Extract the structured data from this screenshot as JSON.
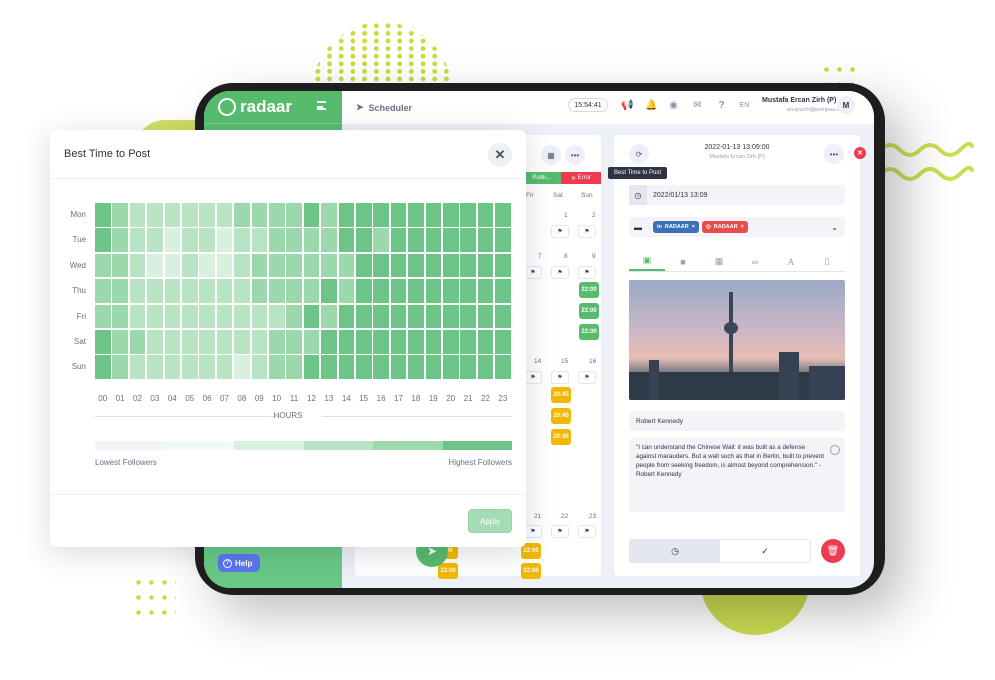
{
  "app": {
    "brand": "radaar",
    "section": "Scheduler",
    "clock": "15:54:41",
    "language": "EN",
    "user": {
      "name": "Mustafa Ercan Zirh (P)",
      "email": "ercanzirh@pompaa.com",
      "initial": "M"
    },
    "help_label": "Help"
  },
  "calendar": {
    "status_tags": {
      "published": "Publi...",
      "error": "Error"
    },
    "day_headers": [
      "Fri",
      "Sat",
      "Sun"
    ],
    "dates": [
      "1",
      "2",
      "7",
      "8",
      "9",
      "14",
      "15",
      "16",
      "21",
      "22",
      "23"
    ],
    "events": {
      "green": [
        "22:00",
        "22:00",
        "22:00"
      ],
      "yellow_mid": [
        "20:45",
        "20:45",
        "20:45"
      ],
      "yellow_bottom_left": [
        ":00",
        "23:00"
      ],
      "yellow_bottom_right": [
        "22:00",
        "22:00"
      ]
    }
  },
  "editor": {
    "timestamp": "2022-01-13 13:09:00",
    "author": "Mustafa Ercan Zirh (P)",
    "tooltip": "Best Time to Post",
    "date_value": "2022/01/13 13:09",
    "accounts": [
      {
        "network": "linkedin",
        "label": "RADAAR",
        "color": "#3b6fb6"
      },
      {
        "network": "instagram",
        "label": "RADAAR",
        "color": "#ea4b4b"
      }
    ],
    "tabs": [
      "image",
      "video",
      "gallery",
      "link",
      "text",
      "mobile"
    ],
    "title_value": "Robert Kennedy",
    "body_value": "\"I can understand the Chinese Wall: it was built as a defense against marauders. But a wall such as that in Berlin, built to prevent people from seeking freedom, is almost beyond comprehension.\" -Robert Kennedy"
  },
  "modal": {
    "title": "Best Time to Post",
    "close_label": "✕",
    "axis_label": "HOURS",
    "legend_low": "Lowest Followers",
    "legend_high": "Highest Followers",
    "apply_label": "Apply",
    "legend_colors": [
      "#f1f4f8",
      "#f2faf4",
      "#d9f0df",
      "#b9e4c4",
      "#9bd9ac",
      "#6cc586"
    ]
  },
  "chart_data": {
    "type": "heatmap",
    "title": "Best Time to Post",
    "xlabel": "HOURS",
    "ylabel": "",
    "x": [
      "00",
      "01",
      "02",
      "03",
      "04",
      "05",
      "06",
      "07",
      "08",
      "09",
      "10",
      "11",
      "12",
      "13",
      "14",
      "15",
      "16",
      "17",
      "18",
      "19",
      "20",
      "21",
      "22",
      "23"
    ],
    "y": [
      "Mon",
      "Tue",
      "Wed",
      "Thu",
      "Fri",
      "Sat",
      "Sun"
    ],
    "scale": {
      "min": 1,
      "max": 5,
      "min_label": "Lowest Followers",
      "max_label": "Highest Followers"
    },
    "values": [
      [
        5,
        4,
        3,
        3,
        3,
        3,
        3,
        3,
        4,
        4,
        4,
        4,
        5,
        4,
        5,
        5,
        5,
        5,
        5,
        5,
        5,
        5,
        5,
        5
      ],
      [
        5,
        4,
        3,
        3,
        2,
        3,
        3,
        2,
        3,
        3,
        4,
        4,
        4,
        4,
        5,
        5,
        4,
        5,
        5,
        5,
        5,
        5,
        5,
        5
      ],
      [
        4,
        4,
        3,
        2,
        2,
        3,
        2,
        2,
        3,
        4,
        4,
        4,
        4,
        4,
        4,
        5,
        5,
        5,
        5,
        5,
        5,
        5,
        5,
        5
      ],
      [
        4,
        4,
        3,
        3,
        3,
        3,
        3,
        3,
        3,
        4,
        4,
        4,
        4,
        5,
        4,
        5,
        5,
        5,
        5,
        5,
        5,
        5,
        5,
        5
      ],
      [
        4,
        4,
        3,
        3,
        3,
        3,
        3,
        3,
        3,
        3,
        3,
        4,
        5,
        4,
        5,
        5,
        5,
        5,
        5,
        5,
        5,
        5,
        5,
        5
      ],
      [
        5,
        4,
        4,
        3,
        3,
        3,
        3,
        3,
        3,
        3,
        4,
        4,
        4,
        5,
        5,
        5,
        5,
        5,
        5,
        5,
        5,
        5,
        5,
        5
      ],
      [
        5,
        4,
        3,
        3,
        3,
        3,
        3,
        3,
        2,
        3,
        4,
        4,
        5,
        5,
        5,
        5,
        5,
        5,
        5,
        5,
        5,
        5,
        5,
        5
      ]
    ]
  }
}
